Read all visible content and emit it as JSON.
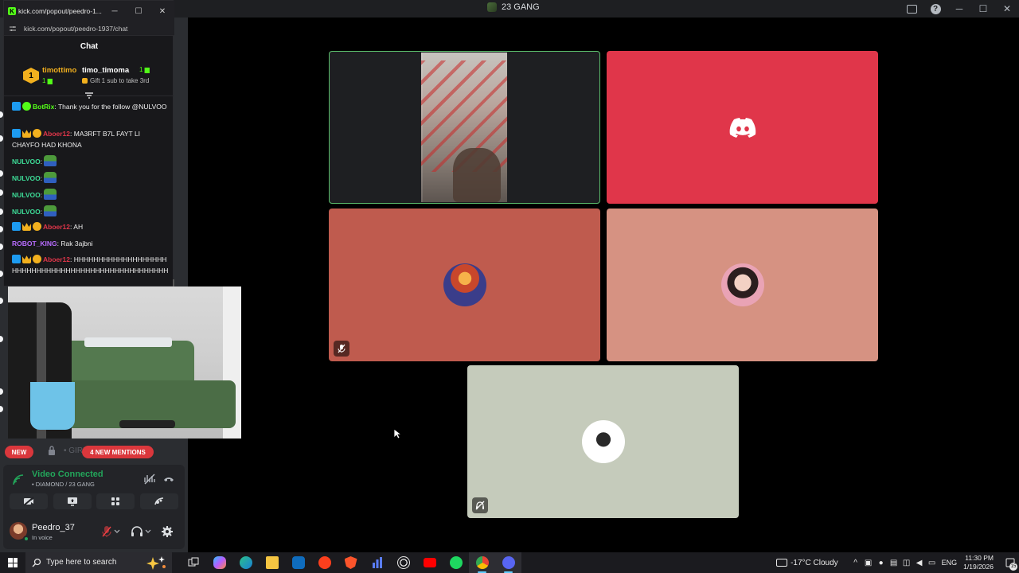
{
  "discord": {
    "window_title": "23 GANG",
    "pills": {
      "new": "NEW",
      "mentions": "4 NEW MENTIONS",
      "channel_hint": "• GIRLS C"
    },
    "voice": {
      "status": "Video Connected",
      "location": "• DIAMOND / 23 GANG"
    },
    "user": {
      "name": "Peedro_37",
      "status": "In voice"
    },
    "colors": {
      "tile_active_border": "#5bbd6c",
      "tile_2": "#e0364a",
      "tile_3": "#bf5b4e",
      "tile_4": "#d69282",
      "tile_5": "#c5cbbb",
      "connected": "#23a55a"
    },
    "tiles": [
      {
        "type": "camera",
        "speaking": true
      },
      {
        "type": "avatar",
        "icon": "discord-logo-icon"
      },
      {
        "type": "avatar",
        "muted": true
      },
      {
        "type": "avatar"
      },
      {
        "type": "avatar",
        "deafened": true
      }
    ]
  },
  "kick": {
    "window_title": "kick.com/popout/peedro-1...",
    "url": "kick.com/popout/peedro-1937/chat",
    "header": "Chat",
    "leaderboard": {
      "rank": "1",
      "user1": "timottimo",
      "user1_sub": "1 ▆",
      "user2": "timo_timoma",
      "user2_badge": "1 ▆",
      "gift_text": "Gift 1 sub to take 3rd"
    },
    "messages": [
      {
        "user": "BotRix",
        "text": "Thank you for the follow @NULVOO"
      },
      {
        "user": "Aboer12",
        "text": "MA3RFT B7L FAYT LI CHAYFO HAD KHONA"
      },
      {
        "user": "NULVOO",
        "text": ""
      },
      {
        "user": "NULVOO",
        "text": ""
      },
      {
        "user": "NULVOO",
        "text": ""
      },
      {
        "user": "NULVOO",
        "text": ""
      },
      {
        "user": "Aboer12",
        "text": "AH"
      },
      {
        "user": "ROBOT_KING",
        "text": "Rak 3ajbni"
      },
      {
        "user": "Aboer12",
        "text": "HHHHHHHHHHHHHHHHHHHHHHHHHHHHHHHHHHHHHHHHHHHHHHHHHHH"
      }
    ]
  },
  "taskbar": {
    "search_placeholder": "Type here to search",
    "weather": "-17°C  Cloudy",
    "lang": "ENG",
    "time": "11:30 PM",
    "date": "1/19/2026",
    "notifications": "15",
    "apps": [
      "task-view",
      "copilot",
      "edge",
      "file-explorer",
      "outlook",
      "yandex",
      "brave",
      "chart-app",
      "obs",
      "youtube",
      "spotify",
      "chrome",
      "discord"
    ]
  }
}
